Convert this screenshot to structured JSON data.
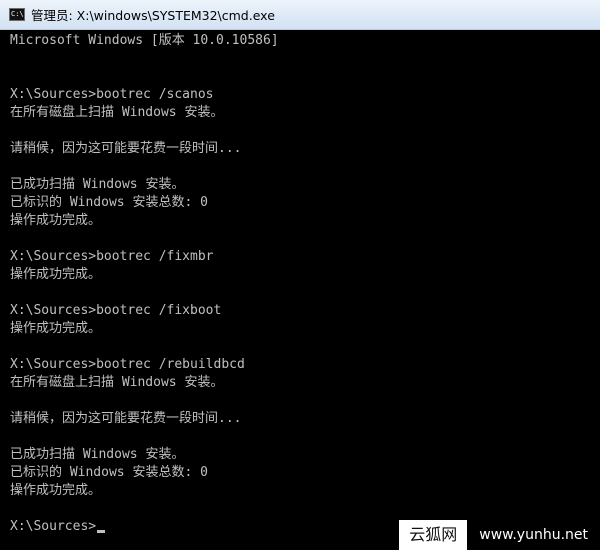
{
  "window": {
    "title": "管理员: X:\\windows\\SYSTEM32\\cmd.exe",
    "icon": "cmd-console-icon",
    "icon_glyph": "C:\\"
  },
  "console": {
    "lines": [
      "Microsoft Windows [版本 10.0.10586]",
      "",
      "",
      "X:\\Sources>bootrec /scanos",
      "在所有磁盘上扫描 Windows 安装。",
      "",
      "请稍候，因为这可能要花费一段时间...",
      "",
      "已成功扫描 Windows 安装。",
      "已标识的 Windows 安装总数: 0",
      "操作成功完成。",
      "",
      "X:\\Sources>bootrec /fixmbr",
      "操作成功完成。",
      "",
      "X:\\Sources>bootrec /fixboot",
      "操作成功完成。",
      "",
      "X:\\Sources>bootrec /rebuildbcd",
      "在所有磁盘上扫描 Windows 安装。",
      "",
      "请稍候，因为这可能要花费一段时间...",
      "",
      "已成功扫描 Windows 安装。",
      "已标识的 Windows 安装总数: 0",
      "操作成功完成。",
      "",
      "X:\\Sources>"
    ],
    "colors": {
      "background": "#000000",
      "text": "#c0c0c0"
    }
  },
  "watermark": {
    "site_name": "云狐网",
    "site_url": "www.yunhu.net"
  }
}
